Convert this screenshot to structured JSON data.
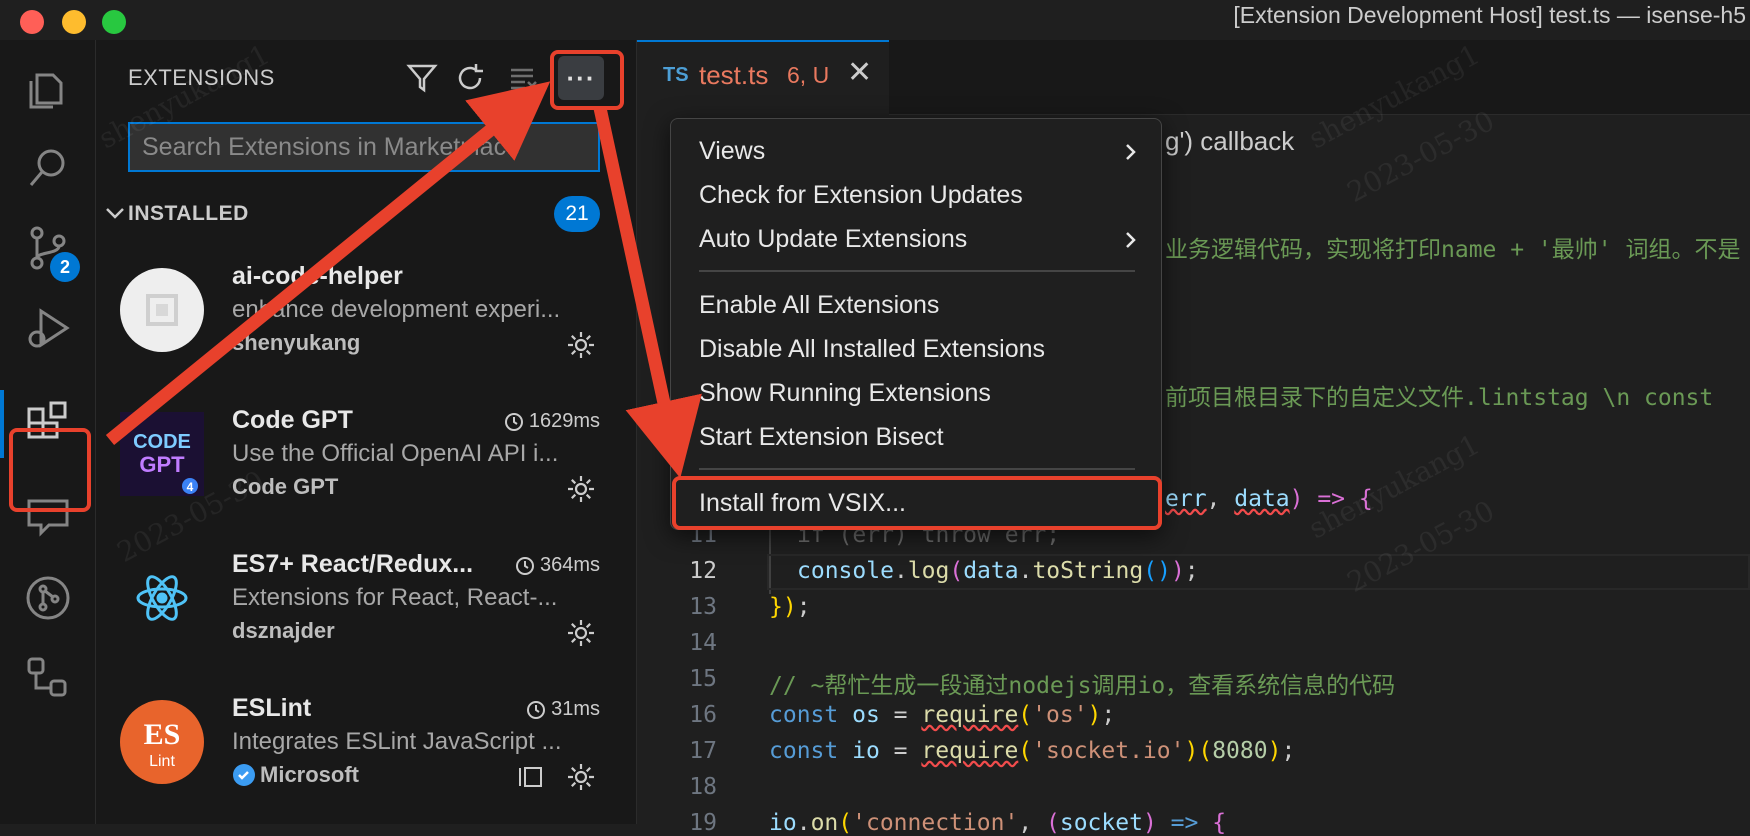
{
  "window": {
    "title": "[Extension Development Host] test.ts — isense-h5"
  },
  "activity_bar": {
    "source_control_badge": "2"
  },
  "sidebar": {
    "title": "EXTENSIONS",
    "more_label": "···",
    "search_placeholder": "Search Extensions in Marketplace",
    "section_label": "INSTALLED",
    "installed_count": "21",
    "extensions": [
      {
        "name": "ai-code-helper",
        "description": "enhance development experi...",
        "publisher": "shenyukang",
        "time": "",
        "logo": "generic-extension-icon"
      },
      {
        "name": "Code GPT",
        "description": "Use the Official OpenAI API i...",
        "publisher": "Code GPT",
        "time": "1629ms",
        "logo": "codegpt-logo",
        "logo_text_1": "CODE",
        "logo_text_2": "GPT",
        "logo_badge": "4"
      },
      {
        "name": "ES7+ React/Redux...",
        "description": "Extensions for React, React-...",
        "publisher": "dsznajder",
        "time": "364ms",
        "logo": "react-atom-logo"
      },
      {
        "name": "ESLint",
        "description": "Integrates ESLint JavaScript ...",
        "publisher": "Microsoft",
        "time": "31ms",
        "logo": "eslint-logo",
        "logo_text_1": "ES",
        "logo_text_2": "Lint",
        "verified": true
      }
    ]
  },
  "editor": {
    "tab": {
      "lang": "TS",
      "name": "test.ts",
      "status": "6, U"
    },
    "lines": {
      "l_cb": "g') callback",
      "l_comment1": "业务逻辑代码，实现将打印name + '最帅' 词组。不是",
      "l_comment2": "前项目根目录下的自定义文件.lintstag \\n const",
      "l10_err": "err",
      "l10_data": "data",
      "l10_arrow": ") => {",
      "l11": "if (err) throw err;",
      "l12_a": "console",
      "l12_b": "log",
      "l12_c": "data",
      "l12_d": "toString",
      "l13": "});",
      "l15": "// ~帮忙生成一段通过nodejs调用io，查看系统信息的代码",
      "l16_os": "os",
      "l16_req": "require",
      "l16_str": "'os'",
      "l17_io": "io",
      "l17_req": "require",
      "l17_str": "'socket.io'",
      "l17_num": "8080",
      "l19_a": "io",
      "l19_b": "on",
      "l19_c": "'connection'",
      "l19_d": "socket"
    },
    "line_numbers": [
      "11",
      "12",
      "13",
      "14",
      "15",
      "16",
      "17",
      "18",
      "19"
    ],
    "keywords": {
      "const": "const"
    }
  },
  "context_menu": {
    "items": [
      {
        "label": "Views",
        "submenu": true
      },
      {
        "label": "Check for Extension Updates",
        "submenu": false
      },
      {
        "label": "Auto Update Extensions",
        "submenu": true
      },
      {
        "label": "Enable All Extensions",
        "submenu": false
      },
      {
        "label": "Disable All Installed Extensions",
        "submenu": false
      },
      {
        "label": "Show Running Extensions",
        "submenu": false
      },
      {
        "label": "Start Extension Bisect",
        "submenu": false
      },
      {
        "label": "Install from VSIX...",
        "submenu": false
      }
    ]
  },
  "watermark": {
    "name": "shenyukang1",
    "date": "2023-05-30"
  },
  "colors": {
    "accent": "#0078d4",
    "annotation_red": "#e8412c",
    "modified_tab": "#e9795f"
  }
}
